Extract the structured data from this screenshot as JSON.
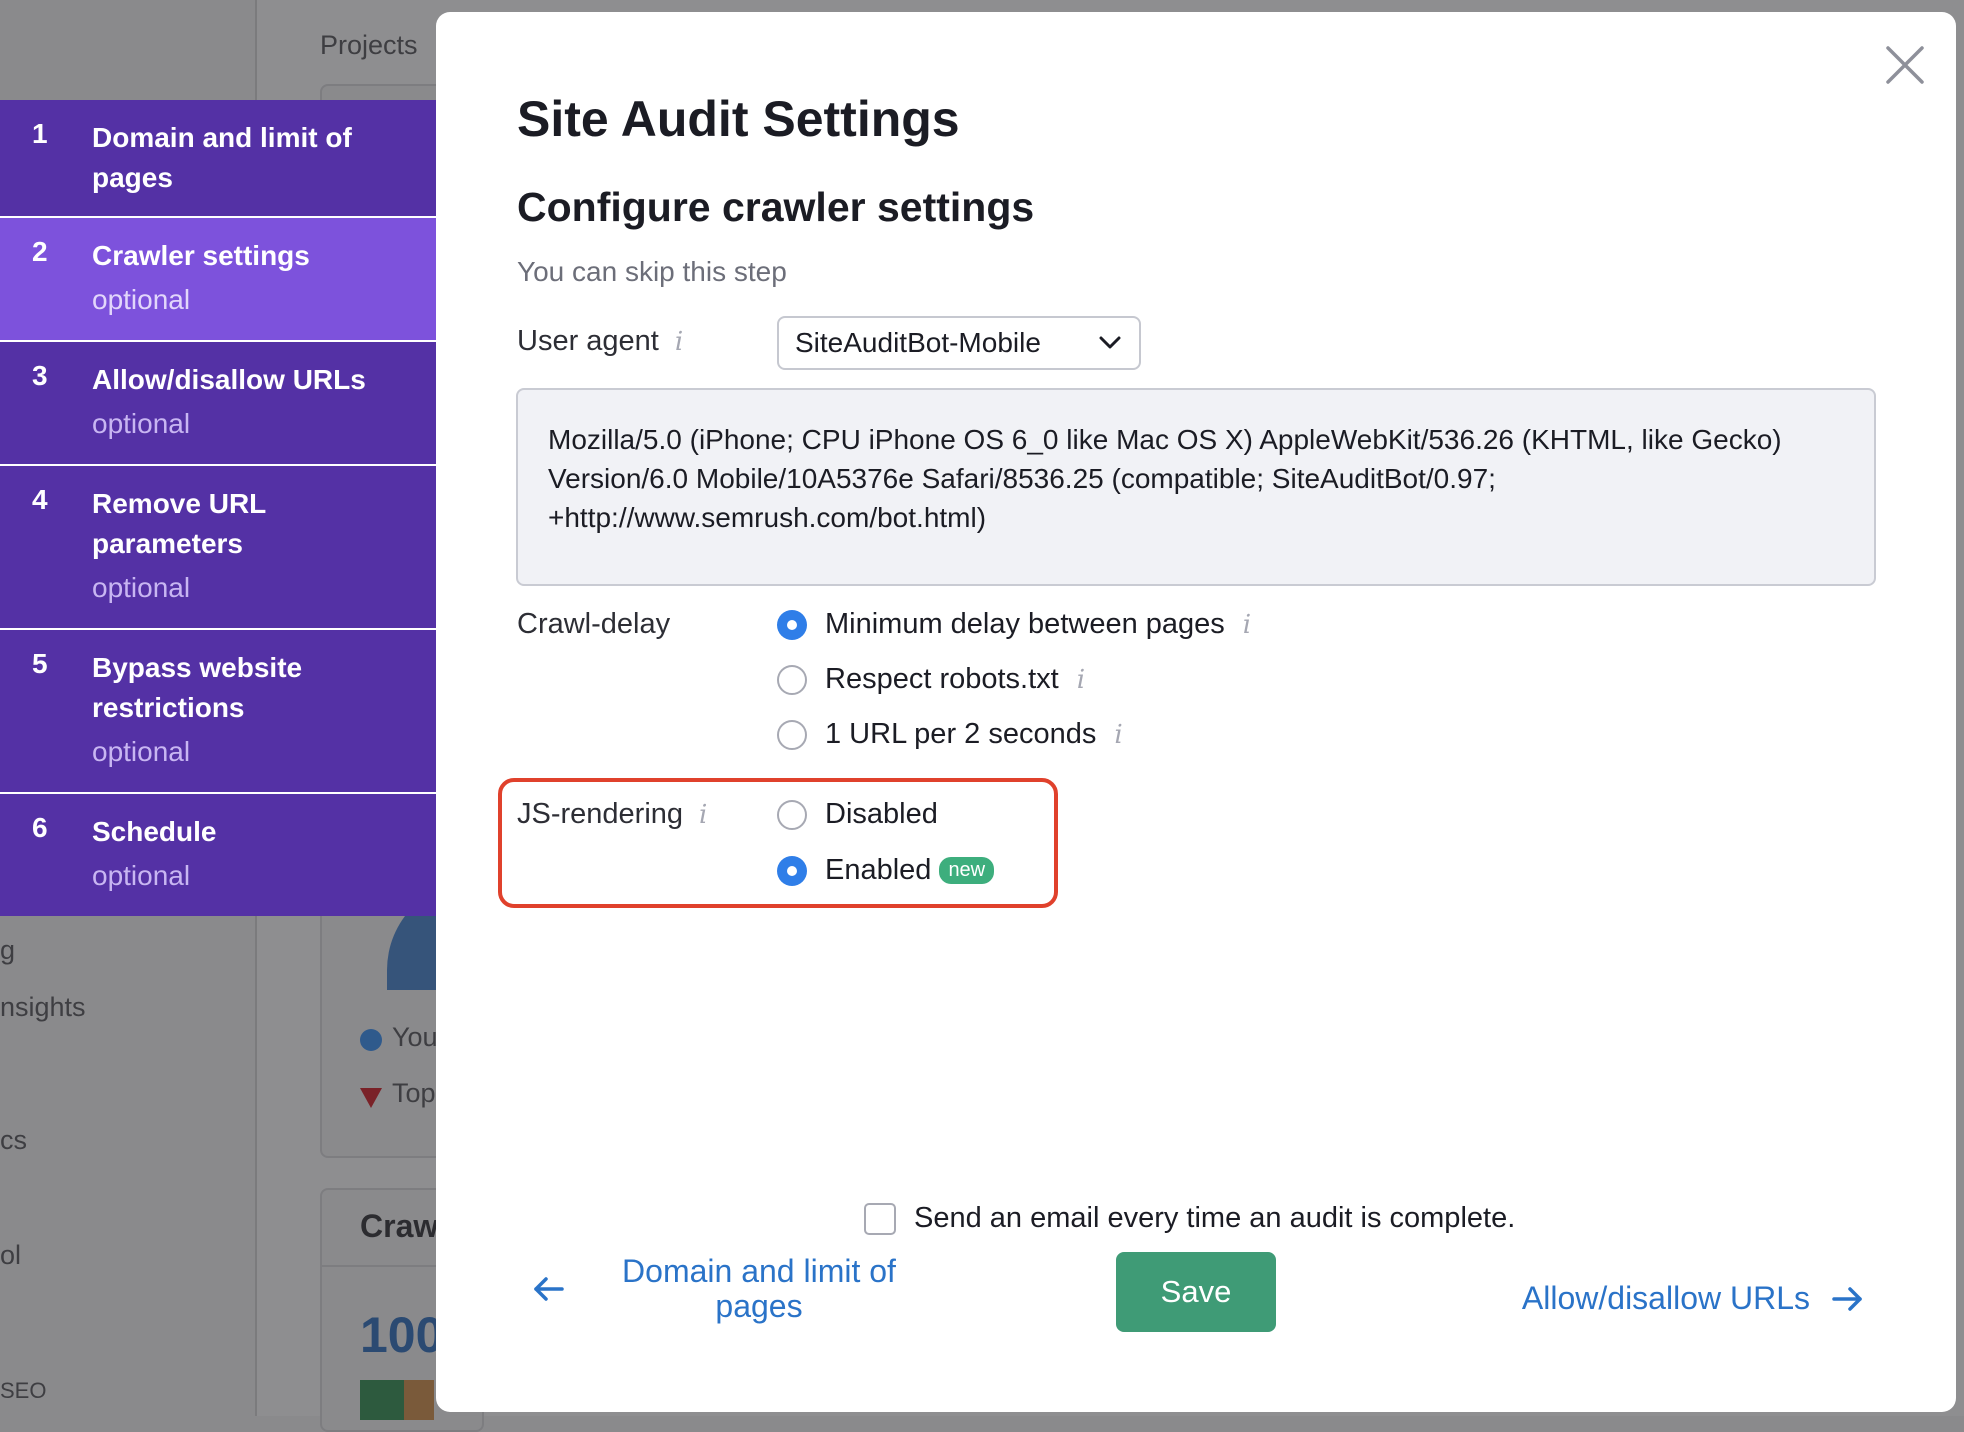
{
  "background": {
    "tab_label": "Projects",
    "sidebar_fragments": [
      "g",
      "nsights",
      "cs",
      "ol",
      "SEO"
    ],
    "legend": [
      "You",
      "Top"
    ],
    "card_title": "Craw",
    "big_number": "100"
  },
  "wizard": {
    "steps": [
      {
        "num": "1",
        "title": "Domain and limit of pages",
        "sub": ""
      },
      {
        "num": "2",
        "title": "Crawler settings",
        "sub": "optional"
      },
      {
        "num": "3",
        "title": "Allow/disallow URLs",
        "sub": "optional"
      },
      {
        "num": "4",
        "title": "Remove URL parameters",
        "sub": "optional"
      },
      {
        "num": "5",
        "title": "Bypass website restrictions",
        "sub": "optional"
      },
      {
        "num": "6",
        "title": "Schedule",
        "sub": "optional"
      }
    ],
    "active_step": 2
  },
  "modal": {
    "title": "Site Audit Settings",
    "section_title": "Configure crawler settings",
    "section_subtitle": "You can skip this step",
    "user_agent": {
      "label": "User agent",
      "selected": "SiteAuditBot-Mobile",
      "string_lines": [
        "Mozilla/5.0 (iPhone; CPU iPhone OS 6_0 like Mac OS X) AppleWebKit/536.26 (KHTML, like Gecko)",
        "Version/6.0 Mobile/10A5376e Safari/8536.25 (compatible; SiteAuditBot/0.97;",
        "+http://www.semrush.com/bot.html)"
      ]
    },
    "crawl_delay": {
      "label": "Crawl-delay",
      "options": [
        "Minimum delay between pages",
        "Respect robots.txt",
        "1 URL per 2 seconds"
      ],
      "selected": "Minimum delay between pages"
    },
    "js_rendering": {
      "label": "JS-rendering",
      "options": [
        "Disabled",
        "Enabled"
      ],
      "selected": "Enabled",
      "badge": "new"
    },
    "email_checkbox": {
      "label": "Send an email every time an audit is complete.",
      "checked": false
    },
    "nav": {
      "prev_label": "Domain and limit of pages",
      "save_label": "Save",
      "next_label": "Allow/disallow URLs"
    }
  },
  "colors": {
    "wizard_bg": "#5431a5",
    "wizard_active": "#7d52dc",
    "accent_blue": "#2f7ee8",
    "save_green": "#3f9b76",
    "link_blue": "#2a73c8",
    "highlight_red": "#e0412c",
    "badge_green": "#3dae7d"
  }
}
